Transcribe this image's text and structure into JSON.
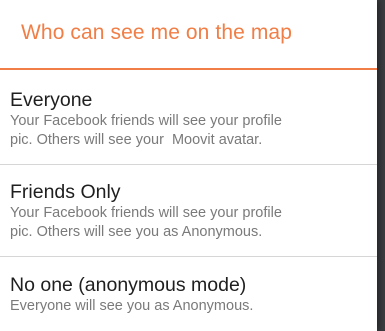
{
  "dialog": {
    "title": "Who can see me on the map",
    "accent_color": "#f07e46",
    "options": [
      {
        "title": "Everyone",
        "description_lines": [
          "Your Facebook friends will see your profile",
          "pic. Others will see your  Moovit avatar."
        ]
      },
      {
        "title": "Friends Only",
        "description_lines": [
          "Your Facebook friends will see your profile",
          "pic. Others will see you as Anonymous."
        ]
      },
      {
        "title": "No one (anonymous mode)",
        "description_lines": [
          "Everyone will see you as Anonymous."
        ]
      }
    ]
  }
}
